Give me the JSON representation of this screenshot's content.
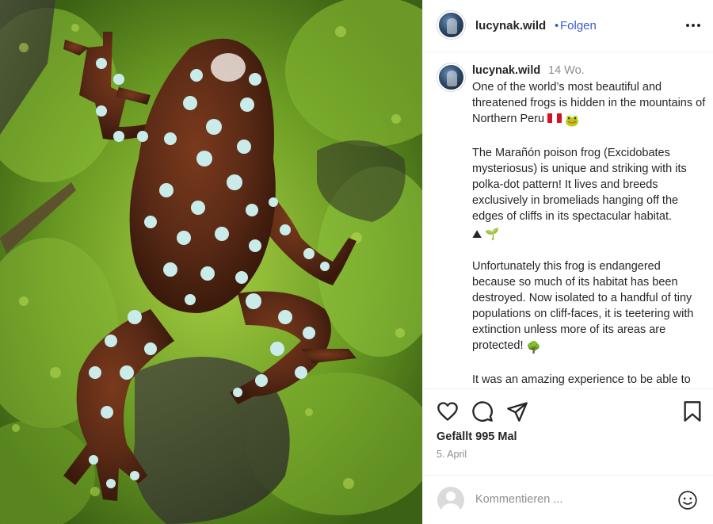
{
  "post": {
    "username": "lucynak.wild",
    "follow_separator": "•",
    "follow_label": "Folgen"
  },
  "caption": {
    "username": "lucynak.wild",
    "time": "14 Wo.",
    "paragraphs": [
      "One of the world’s most beautiful and threatened frogs is hidden in the mountains of Northern Peru",
      "The Marañón poison frog (Excidobates mysteriosus) is unique and striking with its polka-dot pattern! It lives and breeds exclusively in bromeliads hanging off the edges of cliffs in its spectacular habitat.",
      "Unfortunately this frog is endangered because so much of its habitat has been destroyed. Now isolated to a handful of tiny populations on cliff-faces, it is teetering with extinction unless more of its areas are protected!",
      "It was an amazing experience to be able to see these frogs with Jack from"
    ],
    "emoji_frog": "🐸",
    "emoji_mountain": "⛰",
    "emoji_seedling": "🌱",
    "emoji_tree": "🌳"
  },
  "icons": {
    "like": "heart-icon",
    "comment": "comment-icon",
    "share": "share-icon",
    "save": "bookmark-icon",
    "more": "more-icon",
    "emoji": "smile-icon"
  },
  "engagement": {
    "likes": "Gefällt 995 Mal",
    "date": "5. April"
  },
  "comment_box": {
    "placeholder": "Kommentieren ..."
  },
  "colors": {
    "link_blue": "#3a5bd6",
    "muted": "#8e8e8e",
    "text": "#262626",
    "frog_brown": "#5a2a16",
    "frog_spot": "#c9ecea",
    "moss_green": "#5f8f22"
  }
}
